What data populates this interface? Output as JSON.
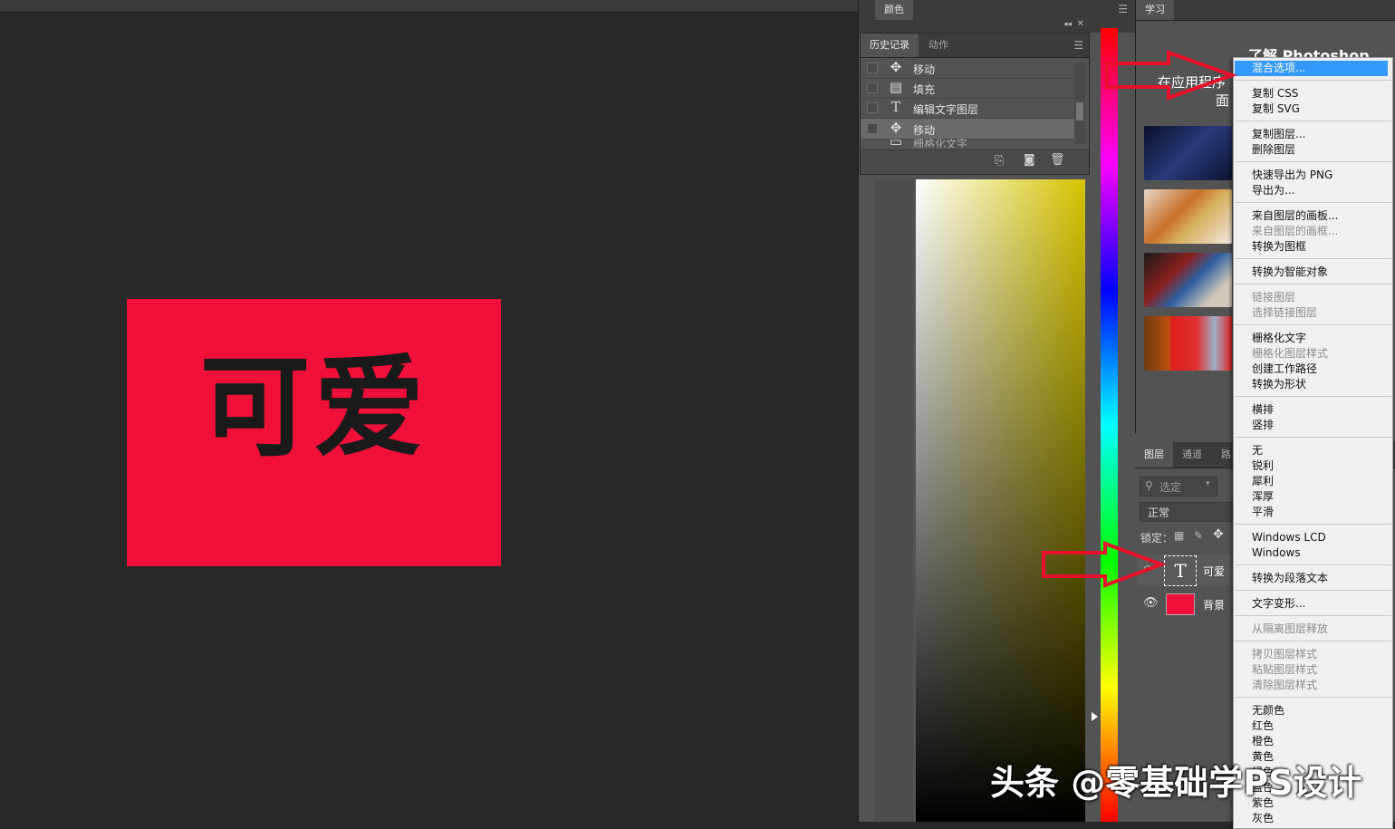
{
  "canvas": {
    "document_text": "可爱",
    "document_color": "#f01039"
  },
  "color_panel": {
    "tab": "颜色"
  },
  "history_panel": {
    "tabs": [
      "历史记录",
      "动作"
    ],
    "items": [
      {
        "icon": "move-icon",
        "label": "移动"
      },
      {
        "icon": "fill-icon",
        "label": "填充"
      },
      {
        "icon": "type-icon",
        "label": "编辑文字图层"
      },
      {
        "icon": "move-icon",
        "label": "移动",
        "selected": true
      },
      {
        "icon": "doc-icon",
        "label": "栅格化文字"
      }
    ]
  },
  "learn_panel": {
    "tab": "学习",
    "title": "了解 Photoshop",
    "subtitle_1": "在应用程序",
    "subtitle_2": "面"
  },
  "layers_panel": {
    "tabs": [
      "图层",
      "通道",
      "路"
    ],
    "filter_placeholder": "选定",
    "blend_mode": "正常",
    "lock_label": "锁定：",
    "layers": [
      {
        "name": "可爱",
        "type": "text"
      },
      {
        "name": "背景",
        "type": "fill",
        "color": "#f01039"
      }
    ]
  },
  "context_menu": {
    "groups": [
      [
        {
          "label": "混合选项...",
          "highlighted": true
        }
      ],
      [
        {
          "label": "复制 CSS"
        },
        {
          "label": "复制 SVG"
        }
      ],
      [
        {
          "label": "复制图层..."
        },
        {
          "label": "删除图层"
        }
      ],
      [
        {
          "label": "快速导出为 PNG"
        },
        {
          "label": "导出为..."
        }
      ],
      [
        {
          "label": "来自图层的画板..."
        },
        {
          "label": "来自图层的画框...",
          "disabled": true
        },
        {
          "label": "转换为图框"
        }
      ],
      [
        {
          "label": "转换为智能对象"
        }
      ],
      [
        {
          "label": "链接图层",
          "disabled": true
        },
        {
          "label": "选择链接图层",
          "disabled": true
        }
      ],
      [
        {
          "label": "栅格化文字"
        },
        {
          "label": "栅格化图层样式",
          "disabled": true
        },
        {
          "label": "创建工作路径"
        },
        {
          "label": "转换为形状"
        }
      ],
      [
        {
          "label": "横排"
        },
        {
          "label": "竖排"
        }
      ],
      [
        {
          "label": "无"
        },
        {
          "label": "锐利"
        },
        {
          "label": "犀利"
        },
        {
          "label": "浑厚"
        },
        {
          "label": "平滑"
        }
      ],
      [
        {
          "label": "Windows LCD"
        },
        {
          "label": "Windows"
        }
      ],
      [
        {
          "label": "转换为段落文本"
        }
      ],
      [
        {
          "label": "文字变形..."
        }
      ],
      [
        {
          "label": "从隔离图层释放",
          "disabled": true
        }
      ],
      [
        {
          "label": "拷贝图层样式",
          "disabled": true
        },
        {
          "label": "粘贴图层样式",
          "disabled": true
        },
        {
          "label": "清除图层样式",
          "disabled": true
        }
      ],
      [
        {
          "label": "无颜色"
        },
        {
          "label": "红色"
        },
        {
          "label": "橙色"
        },
        {
          "label": "黄色"
        },
        {
          "label": "绿色"
        },
        {
          "label": "蓝色"
        },
        {
          "label": "紫色"
        },
        {
          "label": "灰色"
        }
      ]
    ]
  },
  "watermark": "头条 @零基础学PS设计"
}
